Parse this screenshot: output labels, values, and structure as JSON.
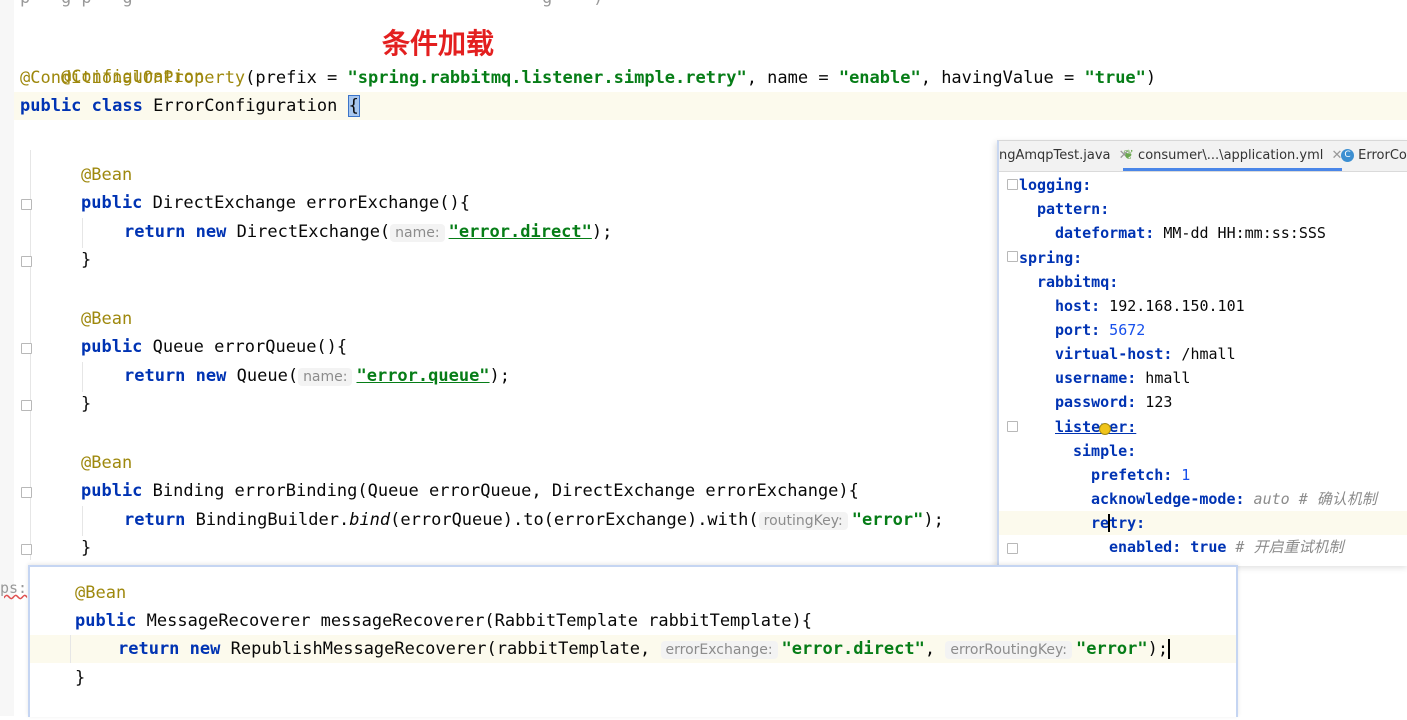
{
  "annotation_title": "条件加载",
  "header": {
    "configuration_annotation": "@Configuration",
    "conditional_annotation": "@ConditionalOnProperty",
    "prefix_key": "(prefix = ",
    "prefix_value": "\"spring.rabbitmq.listener.simple.retry\"",
    "name_key": ", name = ",
    "name_value": "\"enable\"",
    "having_key": ", havingValue = ",
    "having_value": "\"true\"",
    "close_paren": ")",
    "public_kw": "public",
    "class_kw": "class",
    "class_name": "ErrorConfiguration",
    "open_brace": "{"
  },
  "beans": [
    {
      "annotation": "@Bean",
      "public_kw": "public",
      "signature": "DirectExchange errorExchange(){",
      "return_kw": "return",
      "new_kw": "new",
      "ctor": "DirectExchange(",
      "hint": "name:",
      "arg": "\"error.direct\"",
      "tail": ");",
      "close": "}"
    },
    {
      "annotation": "@Bean",
      "public_kw": "public",
      "signature": "Queue errorQueue(){",
      "return_kw": "return",
      "new_kw": "new",
      "ctor": "Queue(",
      "hint": "name:",
      "arg": "\"error.queue\"",
      "tail": ");",
      "close": "}"
    }
  ],
  "binding_bean": {
    "annotation": "@Bean",
    "public_kw": "public",
    "signature": "Binding errorBinding(Queue errorQueue, DirectExchange errorExchange){",
    "return_kw": "return",
    "builder": "BindingBuilder.",
    "bind": "bind",
    "chain": "(errorQueue).to(errorExchange).with(",
    "hint": "routingKey:",
    "arg": "\"error\"",
    "tail": ");",
    "close": "}"
  },
  "recoverer_bean": {
    "annotation": "@Bean",
    "public_kw": "public",
    "signature": "MessageRecoverer messageRecoverer(RabbitTemplate rabbitTemplate){",
    "return_kw": "return",
    "new_kw": "new",
    "ctor": "RepublishMessageRecoverer(rabbitTemplate, ",
    "hint1": "errorExchange:",
    "arg1": "\"error.direct\"",
    "comma": ", ",
    "hint2": "errorRoutingKey:",
    "arg2": "\"error\"",
    "tail": ");",
    "close": "}"
  },
  "class_close": "}",
  "side_fragment": "ps:",
  "yml_panel": {
    "tabs": [
      {
        "label": "ngAmqpTest.java",
        "icon": "close-icon"
      },
      {
        "label": "consumer\\...\\application.yml",
        "icon": "yml-file-icon"
      },
      {
        "label": "ErrorCon",
        "icon": "class-icon"
      }
    ],
    "lines": [
      {
        "key": "logging:",
        "value": "",
        "comment": ""
      },
      {
        "key": "pattern:",
        "value": "",
        "comment": ""
      },
      {
        "key": "dateformat:",
        "value": " MM-dd HH:mm:ss:SSS",
        "comment": ""
      },
      {
        "key": "spring:",
        "value": "",
        "comment": ""
      },
      {
        "key": "rabbitmq:",
        "value": "",
        "comment": ""
      },
      {
        "key": "host:",
        "value": " 192.168.150.101",
        "comment": ""
      },
      {
        "key": "port:",
        "value": " 5672",
        "comment": ""
      },
      {
        "key": "virtual-host:",
        "value": " /hmall",
        "comment": ""
      },
      {
        "key": "username:",
        "value": " hmall",
        "comment": ""
      },
      {
        "key": "password:",
        "value": " 123",
        "comment": ""
      },
      {
        "key": "listener:",
        "value": "",
        "comment": ""
      },
      {
        "key": "simple:",
        "value": "",
        "comment": ""
      },
      {
        "key": "prefetch:",
        "value": " 1",
        "comment": ""
      },
      {
        "key": "acknowledge-mode:",
        "value": " auto",
        "comment": " # 确认机制"
      },
      {
        "key": "retry:",
        "value": "",
        "comment": ""
      },
      {
        "key": "enabled:",
        "value": " true",
        "comment": " # 开启重试机制"
      }
    ]
  }
}
